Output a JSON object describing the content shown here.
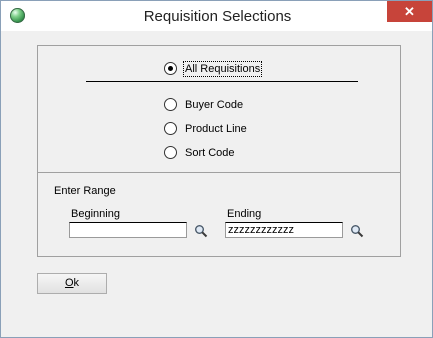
{
  "window": {
    "title": "Requisition Selections",
    "close_glyph": "✕"
  },
  "options": {
    "all": "All Requisitions",
    "buyer": "Buyer Code",
    "product": "Product Line",
    "sort": "Sort Code",
    "selected": "all"
  },
  "range": {
    "label": "Enter Range",
    "beginning_label": "Beginning",
    "beginning_value": "",
    "ending_label": "Ending",
    "ending_value": "zzzzzzzzzzzz",
    "lookup_icon": "magnifier-icon"
  },
  "buttons": {
    "ok_underlined": "O",
    "ok_rest": "k"
  }
}
